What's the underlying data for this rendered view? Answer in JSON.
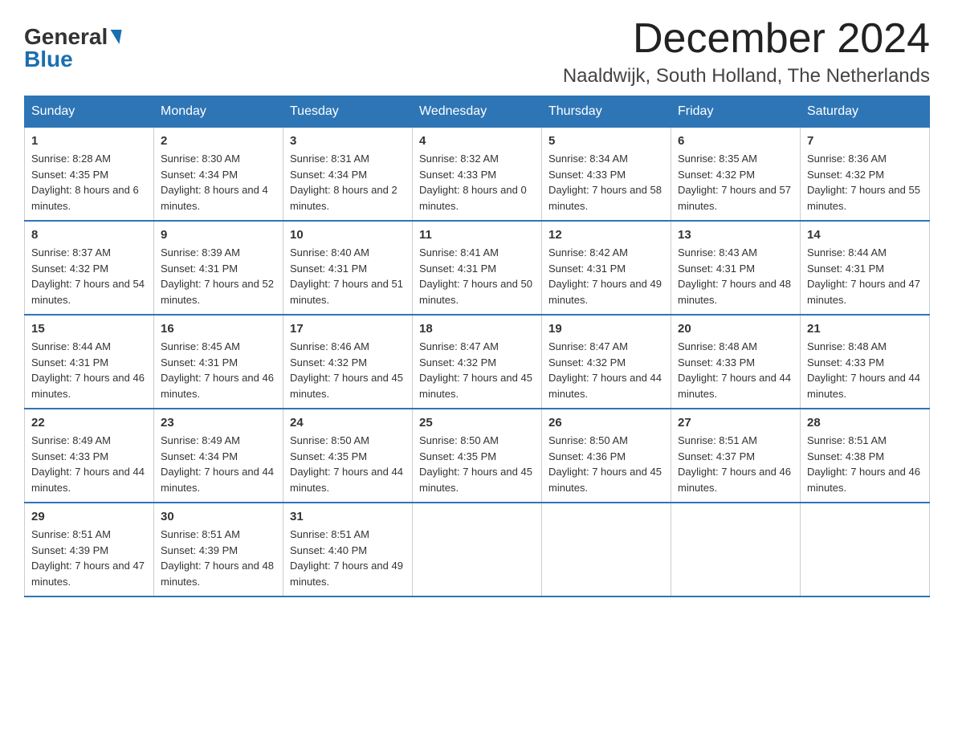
{
  "header": {
    "logo_general": "General",
    "logo_blue": "Blue",
    "main_title": "December 2024",
    "subtitle": "Naaldwijk, South Holland, The Netherlands"
  },
  "calendar": {
    "days_of_week": [
      "Sunday",
      "Monday",
      "Tuesday",
      "Wednesday",
      "Thursday",
      "Friday",
      "Saturday"
    ],
    "weeks": [
      [
        {
          "day": "1",
          "sunrise": "8:28 AM",
          "sunset": "4:35 PM",
          "daylight": "8 hours and 6 minutes."
        },
        {
          "day": "2",
          "sunrise": "8:30 AM",
          "sunset": "4:34 PM",
          "daylight": "8 hours and 4 minutes."
        },
        {
          "day": "3",
          "sunrise": "8:31 AM",
          "sunset": "4:34 PM",
          "daylight": "8 hours and 2 minutes."
        },
        {
          "day": "4",
          "sunrise": "8:32 AM",
          "sunset": "4:33 PM",
          "daylight": "8 hours and 0 minutes."
        },
        {
          "day": "5",
          "sunrise": "8:34 AM",
          "sunset": "4:33 PM",
          "daylight": "7 hours and 58 minutes."
        },
        {
          "day": "6",
          "sunrise": "8:35 AM",
          "sunset": "4:32 PM",
          "daylight": "7 hours and 57 minutes."
        },
        {
          "day": "7",
          "sunrise": "8:36 AM",
          "sunset": "4:32 PM",
          "daylight": "7 hours and 55 minutes."
        }
      ],
      [
        {
          "day": "8",
          "sunrise": "8:37 AM",
          "sunset": "4:32 PM",
          "daylight": "7 hours and 54 minutes."
        },
        {
          "day": "9",
          "sunrise": "8:39 AM",
          "sunset": "4:31 PM",
          "daylight": "7 hours and 52 minutes."
        },
        {
          "day": "10",
          "sunrise": "8:40 AM",
          "sunset": "4:31 PM",
          "daylight": "7 hours and 51 minutes."
        },
        {
          "day": "11",
          "sunrise": "8:41 AM",
          "sunset": "4:31 PM",
          "daylight": "7 hours and 50 minutes."
        },
        {
          "day": "12",
          "sunrise": "8:42 AM",
          "sunset": "4:31 PM",
          "daylight": "7 hours and 49 minutes."
        },
        {
          "day": "13",
          "sunrise": "8:43 AM",
          "sunset": "4:31 PM",
          "daylight": "7 hours and 48 minutes."
        },
        {
          "day": "14",
          "sunrise": "8:44 AM",
          "sunset": "4:31 PM",
          "daylight": "7 hours and 47 minutes."
        }
      ],
      [
        {
          "day": "15",
          "sunrise": "8:44 AM",
          "sunset": "4:31 PM",
          "daylight": "7 hours and 46 minutes."
        },
        {
          "day": "16",
          "sunrise": "8:45 AM",
          "sunset": "4:31 PM",
          "daylight": "7 hours and 46 minutes."
        },
        {
          "day": "17",
          "sunrise": "8:46 AM",
          "sunset": "4:32 PM",
          "daylight": "7 hours and 45 minutes."
        },
        {
          "day": "18",
          "sunrise": "8:47 AM",
          "sunset": "4:32 PM",
          "daylight": "7 hours and 45 minutes."
        },
        {
          "day": "19",
          "sunrise": "8:47 AM",
          "sunset": "4:32 PM",
          "daylight": "7 hours and 44 minutes."
        },
        {
          "day": "20",
          "sunrise": "8:48 AM",
          "sunset": "4:33 PM",
          "daylight": "7 hours and 44 minutes."
        },
        {
          "day": "21",
          "sunrise": "8:48 AM",
          "sunset": "4:33 PM",
          "daylight": "7 hours and 44 minutes."
        }
      ],
      [
        {
          "day": "22",
          "sunrise": "8:49 AM",
          "sunset": "4:33 PM",
          "daylight": "7 hours and 44 minutes."
        },
        {
          "day": "23",
          "sunrise": "8:49 AM",
          "sunset": "4:34 PM",
          "daylight": "7 hours and 44 minutes."
        },
        {
          "day": "24",
          "sunrise": "8:50 AM",
          "sunset": "4:35 PM",
          "daylight": "7 hours and 44 minutes."
        },
        {
          "day": "25",
          "sunrise": "8:50 AM",
          "sunset": "4:35 PM",
          "daylight": "7 hours and 45 minutes."
        },
        {
          "day": "26",
          "sunrise": "8:50 AM",
          "sunset": "4:36 PM",
          "daylight": "7 hours and 45 minutes."
        },
        {
          "day": "27",
          "sunrise": "8:51 AM",
          "sunset": "4:37 PM",
          "daylight": "7 hours and 46 minutes."
        },
        {
          "day": "28",
          "sunrise": "8:51 AM",
          "sunset": "4:38 PM",
          "daylight": "7 hours and 46 minutes."
        }
      ],
      [
        {
          "day": "29",
          "sunrise": "8:51 AM",
          "sunset": "4:39 PM",
          "daylight": "7 hours and 47 minutes."
        },
        {
          "day": "30",
          "sunrise": "8:51 AM",
          "sunset": "4:39 PM",
          "daylight": "7 hours and 48 minutes."
        },
        {
          "day": "31",
          "sunrise": "8:51 AM",
          "sunset": "4:40 PM",
          "daylight": "7 hours and 49 minutes."
        },
        null,
        null,
        null,
        null
      ]
    ]
  }
}
